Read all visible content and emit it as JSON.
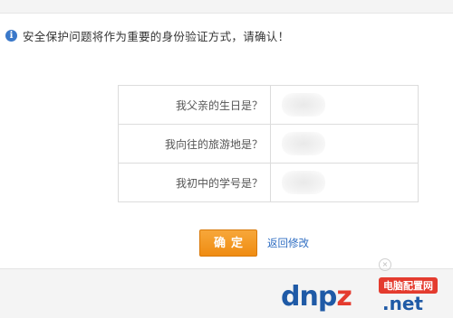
{
  "notice": {
    "icon": "info-icon",
    "text": "安全保护问题将作为重要的身份验证方式，请确认！"
  },
  "questions": [
    {
      "label": "我父亲的生日是？"
    },
    {
      "label": "我向往的旅游地是？"
    },
    {
      "label": "我初中的学号是？"
    }
  ],
  "actions": {
    "confirm_label": "确定",
    "back_label": "返回修改"
  },
  "watermark": {
    "logo": "dnpz",
    "badge": "电脑配置网",
    "domain": ".net"
  },
  "colors": {
    "accent": "#ef8c12",
    "link": "#2e6dc2",
    "info": "#3a78c9"
  }
}
